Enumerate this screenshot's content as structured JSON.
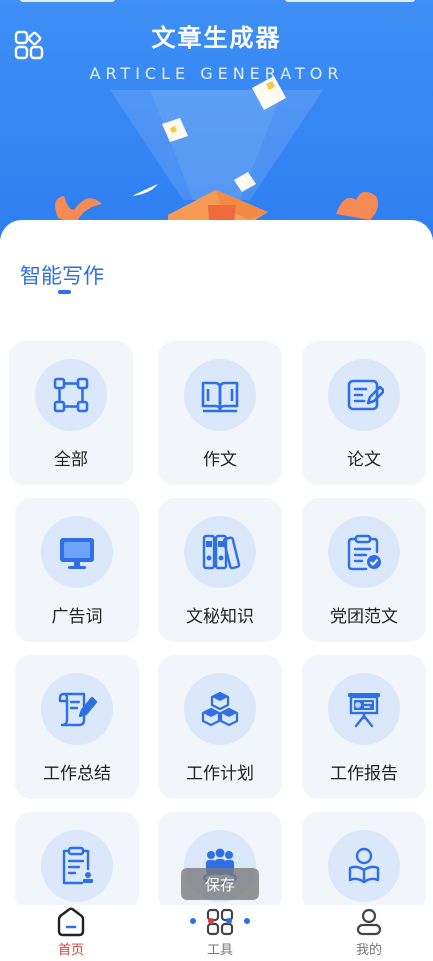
{
  "header": {
    "title": "文章生成器",
    "subtitle": "ARTICLE GENERATOR"
  },
  "section": {
    "title": "智能写作"
  },
  "categories": [
    {
      "label": "全部",
      "icon": "all-nodes-icon"
    },
    {
      "label": "作文",
      "icon": "book-icon"
    },
    {
      "label": "论文",
      "icon": "paper-edit-icon"
    },
    {
      "label": "广告词",
      "icon": "monitor-icon"
    },
    {
      "label": "文秘知识",
      "icon": "binders-icon"
    },
    {
      "label": "党团范文",
      "icon": "clipboard-check-icon"
    },
    {
      "label": "工作总结",
      "icon": "scroll-pen-icon"
    },
    {
      "label": "工作计划",
      "icon": "cubes-icon"
    },
    {
      "label": "工作报告",
      "icon": "presentation-icon"
    },
    {
      "label": "",
      "icon": "document-stamp-icon"
    },
    {
      "label": "",
      "icon": "team-icon"
    },
    {
      "label": "",
      "icon": "reader-icon"
    }
  ],
  "overlay": {
    "save_label": "保存"
  },
  "nav": {
    "items": [
      {
        "label": "首页",
        "icon": "home-icon",
        "active": true
      },
      {
        "label": "工具",
        "icon": "tools-grid-icon",
        "active": false
      },
      {
        "label": "我的",
        "icon": "user-icon",
        "active": false
      }
    ]
  },
  "colors": {
    "brand_blue": "#2e7ef2",
    "accent_text": "#2f6fe6",
    "active_nav": "#e23a3a",
    "card_bg": "#f2f5fa",
    "icon_bubble": "#dbe8fb"
  }
}
